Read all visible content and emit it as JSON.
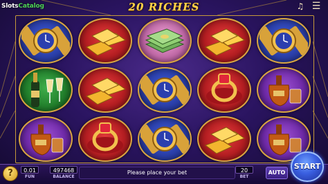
{
  "header": {
    "logo_part1": "Slots",
    "logo_part2": "Catalog",
    "title": "20 RICHES",
    "music_icon": "music-note-icon",
    "menu_icon": "hamburger-menu-icon"
  },
  "reels": [
    [
      "gold-watch",
      "champagne",
      "cognac"
    ],
    [
      "gold-bars",
      "gold-bars",
      "ruby-ring"
    ],
    [
      "cash-stack",
      "gold-watch",
      "gold-watch"
    ],
    [
      "gold-bars",
      "ruby-ring",
      "gold-bars"
    ],
    [
      "gold-watch",
      "cognac",
      "cognac"
    ]
  ],
  "footer": {
    "help_label": "?",
    "fun_value": "0.01",
    "fun_label": "FUN",
    "balance_value": "497468",
    "balance_label": "BALANCE",
    "message": "Please place your bet",
    "bet_value": "20",
    "bet_label": "BET",
    "auto_label": "AUTO",
    "start_label": "START"
  },
  "colors": {
    "accent_gold": "#ffd24a",
    "start_blue": "#3a5fe0",
    "panel_purple": "#2a1458"
  }
}
